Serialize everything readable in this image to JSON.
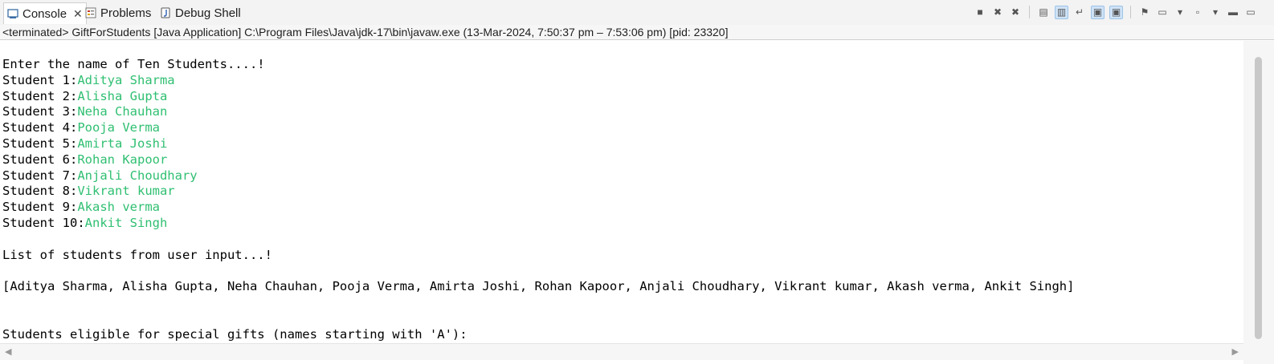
{
  "tabs": [
    {
      "label": "Console",
      "close": "✕"
    },
    {
      "label": "Problems"
    },
    {
      "label": "Debug Shell"
    }
  ],
  "status": "<terminated> GiftForStudents [Java Application] C:\\Program Files\\Java\\jdk-17\\bin\\javaw.exe  (13-Mar-2024, 7:50:37 pm – 7:53:06 pm) [pid: 23320]",
  "console": {
    "header": "Enter the name of Ten Students....!",
    "students": [
      {
        "prompt": "Student 1:",
        "input": "Aditya Sharma"
      },
      {
        "prompt": "Student 2:",
        "input": "Alisha Gupta"
      },
      {
        "prompt": "Student 3:",
        "input": "Neha Chauhan"
      },
      {
        "prompt": "Student 4:",
        "input": "Pooja Verma"
      },
      {
        "prompt": "Student 5:",
        "input": "Amirta Joshi"
      },
      {
        "prompt": "Student 6:",
        "input": "Rohan Kapoor"
      },
      {
        "prompt": "Student 7:",
        "input": "Anjali Choudhary"
      },
      {
        "prompt": "Student 8:",
        "input": "Vikrant kumar"
      },
      {
        "prompt": "Student 9:",
        "input": "Akash verma"
      },
      {
        "prompt": "Student 10:",
        "input": "Ankit Singh"
      }
    ],
    "list_header": "List of students from user input...!",
    "list": "[Aditya Sharma, Alisha Gupta, Neha Chauhan, Pooja Verma, Amirta Joshi, Rohan Kapoor, Anjali Choudhary, Vikrant kumar, Akash verma, Ankit Singh]",
    "eligible_header": "Students eligible for special gifts (names starting with 'A'):"
  },
  "colors": {
    "input_text": "#2fbf71",
    "active_toggle": "#cfe3f7"
  },
  "icons": {
    "console": "console-icon",
    "problems": "problems-icon",
    "debug": "debug-shell-icon"
  }
}
